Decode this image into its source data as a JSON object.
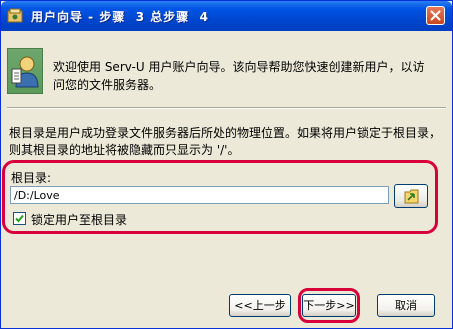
{
  "window": {
    "title": "用户向导 - 步骤  3 总步骤  4"
  },
  "banner": {
    "icon": "user-wizard-icon",
    "text": "欢迎使用  Serv-U 用户账户向导。该向导帮助您快速创建新用户，以访问您的文件服务器。"
  },
  "description": "根目录是用户成功登录文件服务器后所处的物理位置。如果将用户锁定于根目录，则其根目录的地址将被隐藏而只显示为  '/'。",
  "root_dir": {
    "label": "根目录:",
    "value": "/D:/Love",
    "browse_icon": "browse-folder-icon"
  },
  "lock_root": {
    "label": "锁定用户至根目录",
    "checked": true
  },
  "buttons": {
    "prev": "<<上一步",
    "next": "下一步>>",
    "cancel": "取消"
  },
  "colors": {
    "highlight": "#D8003A",
    "titlebar": "#0055E5"
  }
}
